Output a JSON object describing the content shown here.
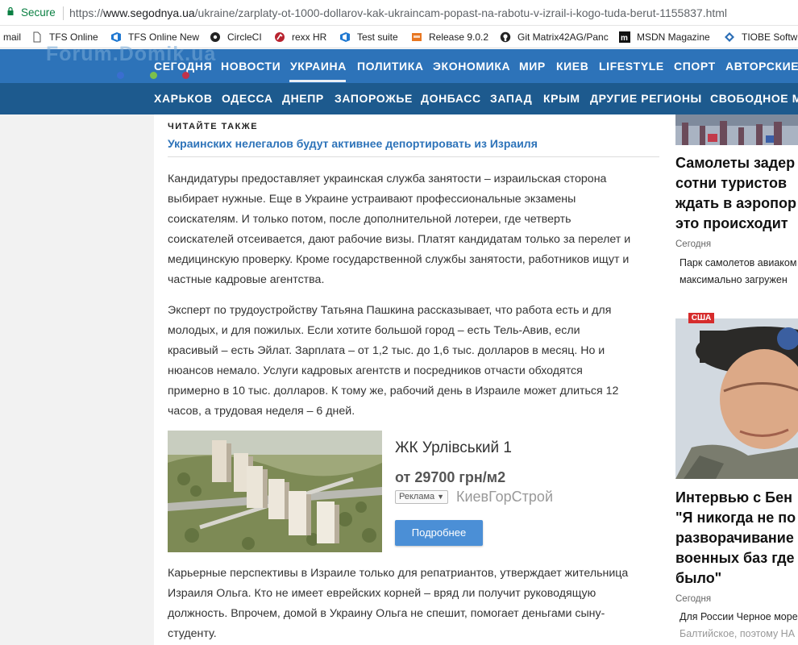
{
  "browser": {
    "secure_label": "Secure",
    "url_prefix": "https://",
    "url_domain": "www.segodnya.ua",
    "url_path": "/ukraine/zarplaty-ot-1000-dollarov-kak-ukraincam-popast-na-rabotu-v-izrail-i-kogo-tuda-berut-1155837.html"
  },
  "bookmarks": [
    {
      "label": "mail",
      "icon": "mail-icon"
    },
    {
      "label": "TFS Online",
      "icon": "page-icon"
    },
    {
      "label": "TFS Online New",
      "icon": "vsts-icon"
    },
    {
      "label": "CircleCI",
      "icon": "circleci-icon"
    },
    {
      "label": "rexx HR",
      "icon": "rexx-icon"
    },
    {
      "label": "Test suite",
      "icon": "vsts-icon"
    },
    {
      "label": "Release 9.0.2",
      "icon": "bookmark-icon"
    },
    {
      "label": "Git Matrix42AG/Panc",
      "icon": "github-icon"
    },
    {
      "label": "MSDN Magazine",
      "icon": "msdn-icon"
    },
    {
      "label": "TIOBE Softw",
      "icon": "tiobe-icon"
    }
  ],
  "site": {
    "watermark": "Forum.Domik.ua",
    "logo": "СЕГОДНЯ"
  },
  "nav_primary": [
    "НОВОСТИ",
    "УКРАИНА",
    "ПОЛИТИКА",
    "ЭКОНОМИКА",
    "МИР",
    "КИЕВ",
    "LIFESTYLE",
    "СПОРТ",
    "АВТОРСКИЕ"
  ],
  "nav_secondary": [
    "ХАРЬКОВ",
    "ОДЕССА",
    "ДНЕПР",
    "ЗАПОРОЖЬЕ",
    "ДОНБАСС",
    "ЗАПАД",
    "КРЫМ",
    "ДРУГИЕ РЕГИОНЫ",
    "СВОБОДНОЕ М"
  ],
  "article": {
    "read_also_label": "ЧИТАЙТЕ ТАКЖЕ",
    "read_also_link": "Украинских нелегалов будут активнее депортировать из Израиля",
    "p1_lines": [
      "Кандидатуры предоставляет украинская служба занятости – израильская сторона",
      "выбирает нужные. Еще в Украине устраивают профессиональные экзамены",
      "соискателям. И только потом, после дополнительной лотереи, где четверть",
      "соискателей отсеивается, дают рабочие визы. Платят кандидатам только за перелет и",
      "медицинскую проверку. Кроме государственной службы занятости, работников ищут и",
      "частные кадровые агентства."
    ],
    "p2_lines": [
      "Эксперт по трудоустройству Татьяна Пашкина рассказывает, что работа есть и для",
      "молодых, и для пожилых. Если хотите большой город – есть Тель-Авив, если",
      "красивый – есть Эйлат. Зарплата – от 1,2 тыс. до 1,6 тыс. долларов в месяц. Но и",
      "нюансов немало. Услуги кадровых агентств и посредников отчасти обходятся",
      "примерно в 10 тыс. долларов. К тому же, рабочий день в Израиле может длиться 12",
      "часов, а трудовая неделя – 6 дней."
    ],
    "p3_lines": [
      "Карьерные перспективы в Израиле только для репатриантов, утверждает жительница",
      "Израиля Ольга. Кто не имеет еврейских корней – вряд ли получит руководящую",
      "должность. Впрочем, домой в Украину Ольга не спешит, помогает деньгами сыну-",
      "студенту."
    ]
  },
  "ad": {
    "title": "ЖК Урлівський 1",
    "price": "от 29700 грн/м2",
    "tag": "Реклама",
    "company": "КиевГорСтрой",
    "button": "Подробнее"
  },
  "sidebar": {
    "story1": {
      "headline_lines": [
        "Самолеты задер",
        "сотни туристов",
        "ждать в аэропор",
        "это происходит"
      ],
      "source": "Сегодня",
      "desc_lines": [
        "Парк самолетов авиаком",
        "максимально загружен"
      ]
    },
    "story2": {
      "badge": "США",
      "headline_lines": [
        "Интервью с Бен",
        "\"Я никогда не по",
        "разворачивание",
        "военных баз где",
        "было\""
      ],
      "source": "Сегодня",
      "desc_lines": [
        "Для России Черное море",
        "Балтийское, поэтому НА"
      ]
    }
  }
}
